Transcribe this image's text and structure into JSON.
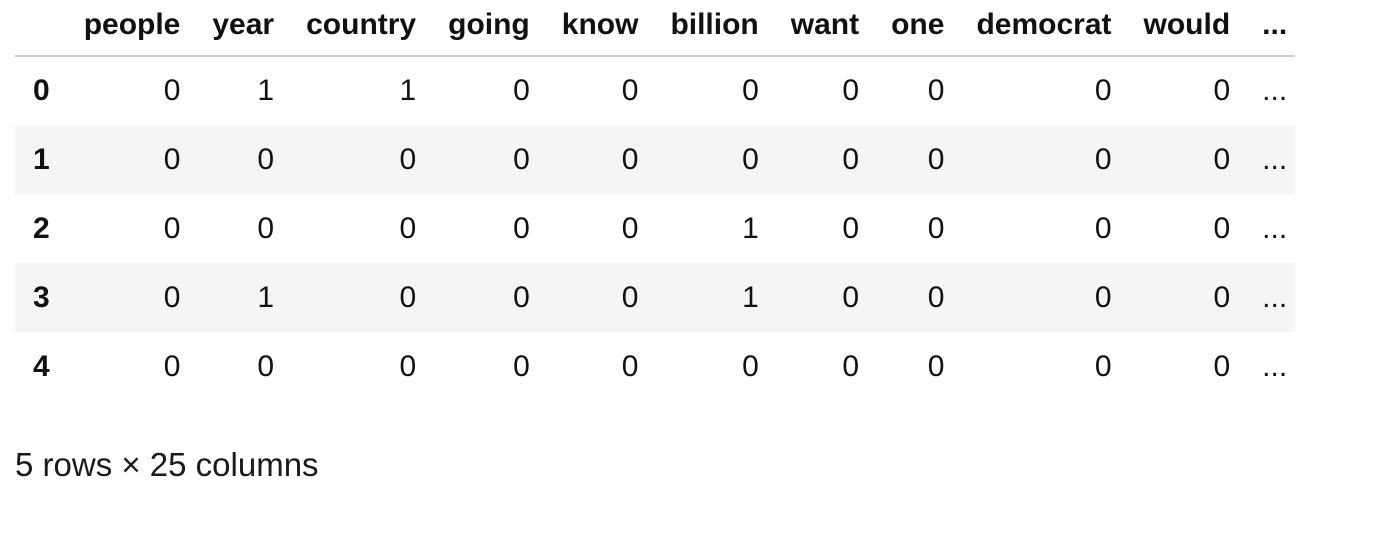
{
  "table": {
    "index_header": "",
    "columns": [
      "people",
      "year",
      "country",
      "going",
      "know",
      "billion",
      "want",
      "one",
      "democrat",
      "would",
      "..."
    ],
    "rows": [
      {
        "index": "0",
        "cells": [
          "0",
          "1",
          "1",
          "0",
          "0",
          "0",
          "0",
          "0",
          "0",
          "0",
          "..."
        ]
      },
      {
        "index": "1",
        "cells": [
          "0",
          "0",
          "0",
          "0",
          "0",
          "0",
          "0",
          "0",
          "0",
          "0",
          "..."
        ]
      },
      {
        "index": "2",
        "cells": [
          "0",
          "0",
          "0",
          "0",
          "0",
          "1",
          "0",
          "0",
          "0",
          "0",
          "..."
        ]
      },
      {
        "index": "3",
        "cells": [
          "0",
          "1",
          "0",
          "0",
          "0",
          "1",
          "0",
          "0",
          "0",
          "0",
          "..."
        ]
      },
      {
        "index": "4",
        "cells": [
          "0",
          "0",
          "0",
          "0",
          "0",
          "0",
          "0",
          "0",
          "0",
          "0",
          "..."
        ]
      }
    ]
  },
  "footer": {
    "summary": "5 rows × 25 columns"
  }
}
